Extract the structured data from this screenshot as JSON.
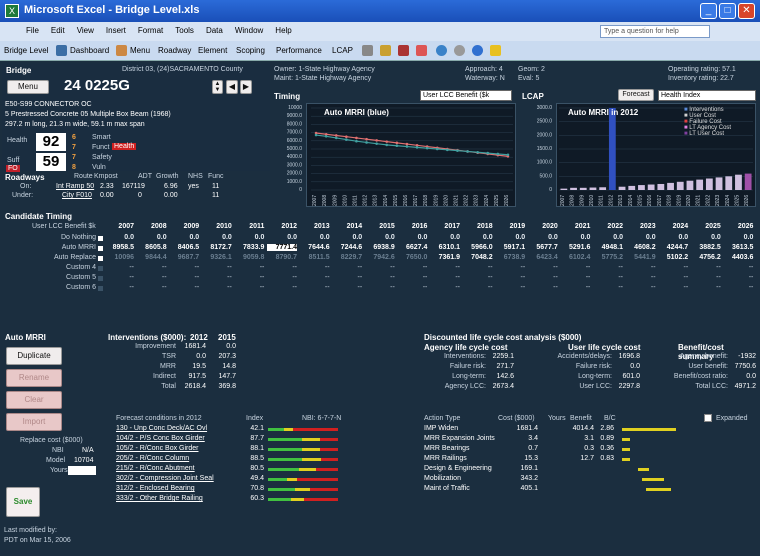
{
  "window": {
    "title": "Microsoft Excel - Bridge Level.xls"
  },
  "menu": {
    "items": [
      "File",
      "Edit",
      "View",
      "Insert",
      "Format",
      "Tools",
      "Data",
      "Window",
      "Help"
    ],
    "search_placeholder": "Type a question for help"
  },
  "toolbar": {
    "items": [
      "Bridge Level",
      "Dashboard",
      "Menu",
      "Roadway",
      "Element",
      "Scoping",
      "Performance",
      "LCAP"
    ]
  },
  "bridge": {
    "header": "Bridge",
    "district": "District 03, (24)SACRAMENTO County",
    "menu_label": "Menu",
    "id": "24 0225G",
    "name": "E50-S99 CONNECTOR OC",
    "desc1": "5 Prestressed Concrete 05 Multiple Box Beam (1968)",
    "desc2": "297.2 m long, 21.3 m wide, 59.1 m max span",
    "owner": "Owner: 1-State Highway Agency",
    "maint": "Maint: 1-State Highway Agency",
    "approach": "Approach: 4",
    "waterway": "Waterway: N",
    "geom": "Geom: 2",
    "eval": "Eval: 5",
    "operating": "Operating rating: 57.1",
    "inventory": "Inventory rating: 22.7",
    "health_label": "Health",
    "health": "92",
    "suff_label": "Suff",
    "suff": "59",
    "fo": "FO",
    "nbi": [
      "6",
      "7",
      "7",
      "8"
    ],
    "flags": [
      "Smart",
      "Funct",
      "Safety",
      "Vuln"
    ],
    "funct_badge": "Health"
  },
  "roadways": {
    "headers": [
      "Roadways",
      "Route",
      "Kmpost",
      "ADT",
      "Growth",
      "NHS",
      "Func"
    ],
    "rows": [
      [
        "On:",
        "Int Ramp 50",
        "2.33",
        "167119",
        "6.96",
        "yes",
        "11"
      ],
      [
        "Under:",
        "City F010",
        "0.00",
        "0",
        "0.00",
        "",
        "11"
      ]
    ]
  },
  "timing": {
    "title": "Timing",
    "select": "User LCC Benefit ($k",
    "chart_title": "Auto MRRI (blue)"
  },
  "lcap": {
    "title": "LCAP",
    "forecast_btn": "Forecast",
    "select": "Health Index",
    "chart_title": "Auto MRRI in 2012",
    "legend": [
      "Interventions",
      "User Cost",
      "Failure Cost",
      "LT Agency Cost",
      "LT User Cost"
    ]
  },
  "chart_data": [
    {
      "type": "line",
      "title": "Auto MRRI (blue)",
      "x": [
        2007,
        2008,
        2009,
        2010,
        2011,
        2012,
        2013,
        2014,
        2015,
        2016,
        2017,
        2018,
        2019,
        2020,
        2021,
        2022,
        2023,
        2024,
        2025,
        2026
      ],
      "series": [
        {
          "name": "",
          "values": [
            6950,
            6800,
            6650,
            6500,
            6350,
            6200,
            6050,
            5900,
            5750,
            5600,
            5450,
            5300,
            5150,
            5000,
            4850,
            4700,
            4550,
            4400,
            4250,
            4100
          ]
        },
        {
          "name": "",
          "values": [
            6700,
            6550,
            6350,
            6150,
            5950,
            5800,
            5650,
            5500,
            5400,
            5300,
            5200,
            5100,
            5000,
            4900,
            4800,
            4700,
            4600,
            4500,
            4400,
            4300
          ]
        }
      ],
      "ylim": [
        0,
        10000
      ],
      "yticks": [
        "0",
        "1000.0",
        "2000.0",
        "3000.0",
        "4000.0",
        "5000.0",
        "6000.0",
        "7000.0",
        "8000.0",
        "9000.0",
        "10000"
      ]
    },
    {
      "type": "bar",
      "title": "Auto MRRI in 2012",
      "x": [
        2007,
        2008,
        2009,
        2010,
        2011,
        2012,
        2013,
        2014,
        2015,
        2016,
        2017,
        2018,
        2019,
        2020,
        2021,
        2022,
        2023,
        2024,
        2025,
        2026
      ],
      "values": [
        50,
        80,
        80,
        90,
        100,
        3000,
        120,
        150,
        180,
        200,
        220,
        260,
        300,
        340,
        380,
        420,
        460,
        500,
        560,
        600
      ],
      "ylim": [
        0,
        3000
      ],
      "yticks": [
        "0",
        "500.0",
        "1000.0",
        "1500.0",
        "2000.0",
        "2500.0",
        "3000.0"
      ]
    }
  ],
  "candidate": {
    "title": "Candidate Timing",
    "row_header": "User LCC Benefit $k",
    "years": [
      "2007",
      "2008",
      "2009",
      "2010",
      "2011",
      "2012",
      "2013",
      "2014",
      "2015",
      "2016",
      "2017",
      "2018",
      "2019",
      "2020",
      "2021",
      "2022",
      "2023",
      "2024",
      "2025",
      "2026"
    ],
    "rows": [
      {
        "label": "Do Nothing",
        "values": [
          "0.0",
          "0.0",
          "0.0",
          "0.0",
          "0.0",
          "0.0",
          "0.0",
          "0.0",
          "0.0",
          "0.0",
          "0.0",
          "0.0",
          "0.0",
          "0.0",
          "0.0",
          "0.0",
          "0.0",
          "0.0",
          "0.0",
          "0.0"
        ]
      },
      {
        "label": "Auto MRRI",
        "values": [
          "8958.5",
          "8605.8",
          "8406.5",
          "8172.7",
          "7833.9",
          "7771.4",
          "7644.6",
          "7244.6",
          "6938.9",
          "6627.4",
          "6310.1",
          "5966.0",
          "5917.1",
          "5677.7",
          "5291.6",
          "4948.1",
          "4608.2",
          "4244.7",
          "3882.5",
          "3613.5"
        ]
      },
      {
        "label": "Auto Replace",
        "values": [
          "10096",
          "9844.4",
          "9687.7",
          "9326.1",
          "9059.8",
          "8790.7",
          "8511.5",
          "8229.7",
          "7942.6",
          "7650.0",
          "7361.9",
          "7048.2",
          "6738.9",
          "6423.4",
          "6102.4",
          "5775.2",
          "5441.9",
          "5102.2",
          "4756.2",
          "4403.6"
        ]
      },
      {
        "label": "Custom 4",
        "values": [
          "--",
          "--",
          "--",
          "--",
          "--",
          "--",
          "--",
          "--",
          "--",
          "--",
          "--",
          "--",
          "--",
          "--",
          "--",
          "--",
          "--",
          "--",
          "--",
          "--"
        ]
      },
      {
        "label": "Custom 5",
        "values": [
          "--",
          "--",
          "--",
          "--",
          "--",
          "--",
          "--",
          "--",
          "--",
          "--",
          "--",
          "--",
          "--",
          "--",
          "--",
          "--",
          "--",
          "--",
          "--",
          "--"
        ]
      },
      {
        "label": "Custom 6",
        "values": [
          "--",
          "--",
          "--",
          "--",
          "--",
          "--",
          "--",
          "--",
          "--",
          "--",
          "--",
          "--",
          "--",
          "--",
          "--",
          "--",
          "--",
          "--",
          "--",
          "--"
        ]
      }
    ]
  },
  "auto": {
    "title": "Auto MRRI",
    "duplicate": "Duplicate",
    "rename": "Rename",
    "clear": "Clear",
    "import": "Import",
    "save": "Save",
    "interventions_title": "Interventions ($000):",
    "y1": "2012",
    "y2": "2015",
    "rows": [
      [
        "Improvement",
        "1681.4",
        "0.0"
      ],
      [
        "TSR",
        "0.0",
        "207.3"
      ],
      [
        "MRR",
        "19.5",
        "14.8"
      ],
      [
        "Indirect",
        "917.5",
        "147.7"
      ],
      [
        "Total",
        "2618.4",
        "369.8"
      ]
    ],
    "replace_cost_label": "Replace cost ($000)",
    "replace_cost": "",
    "nbi_label": "NBI",
    "nbi": "N/A",
    "model_label": "Model",
    "model": "10704",
    "yours_label": "Yours",
    "modified": "Last modified by:",
    "modified2": "PDT on Mar 15, 2006"
  },
  "dlcc": {
    "title": "Discounted life cycle cost analysis ($000)",
    "agency_title": "Agency life cycle cost",
    "user_title": "User life cycle cost",
    "bc_title": "Benefit/cost summary",
    "agency": [
      [
        "Interventions:",
        "2259.1"
      ],
      [
        "Failure risk:",
        "271.7"
      ],
      [
        "Long-term:",
        "142.6"
      ],
      [
        "Agency LCC:",
        "2673.4"
      ]
    ],
    "user": [
      [
        "Accidents/delays:",
        "1696.8"
      ],
      [
        "Failure risk:",
        "0.0"
      ],
      [
        "Long-term:",
        "601.0"
      ],
      [
        "User LCC:",
        "2297.8"
      ]
    ],
    "bc": [
      [
        "Agency benefit:",
        "-1932"
      ],
      [
        "User benefit:",
        "7750.6"
      ],
      [
        "Benefit/cost ratio:",
        "0.0"
      ],
      [
        "Total LCC:",
        "4971.2"
      ]
    ]
  },
  "forecast": {
    "title": "Forecast conditions in 2012",
    "index": "Index",
    "nbi": "NBI: 6-7-7-N",
    "rows": [
      {
        "name": "130 - Unp Conc Deck/AC Ovl",
        "v": "42.1",
        "level": 0.42
      },
      {
        "name": "104/2 - P/S Conc Box Girder",
        "v": "87.7",
        "level": 0.88
      },
      {
        "name": "105/2 - R/Conc Box Girder",
        "v": "88.1",
        "level": 0.88
      },
      {
        "name": "205/2 - R/Conc Column",
        "v": "88.5",
        "level": 0.89
      },
      {
        "name": "215/2 - R/Conc Abutment",
        "v": "80.5",
        "level": 0.81
      },
      {
        "name": "302/2 - Compression Joint Seal",
        "v": "49.4",
        "level": 0.49
      },
      {
        "name": "312/2 - Enclosed Bearing",
        "v": "70.8",
        "level": 0.71
      },
      {
        "name": "333/2 - Other Bridge Railing",
        "v": "60.3",
        "level": 0.6
      }
    ]
  },
  "actions": {
    "headers": [
      "Action Type",
      "Cost ($000)",
      "Yours",
      "Benefit",
      "B/C"
    ],
    "expanded": "Expanded",
    "rows": [
      [
        "IMP Widen",
        "1681.4",
        "",
        "4014.4",
        "2.86"
      ],
      [
        "MRR Expansion Joints",
        "3.4",
        "",
        "3.1",
        "0.89"
      ],
      [
        "MRR Bearings",
        "0.7",
        "",
        "0.3",
        "0.36"
      ],
      [
        "MRR Railings",
        "15.3",
        "",
        "12.7",
        "0.83"
      ],
      [
        "Design & Engineering",
        "169.1",
        "",
        "",
        ""
      ],
      [
        "Mobilization",
        "343.2",
        "",
        "",
        ""
      ],
      [
        "Maint of Traffic",
        "405.1",
        "",
        "",
        ""
      ]
    ]
  }
}
